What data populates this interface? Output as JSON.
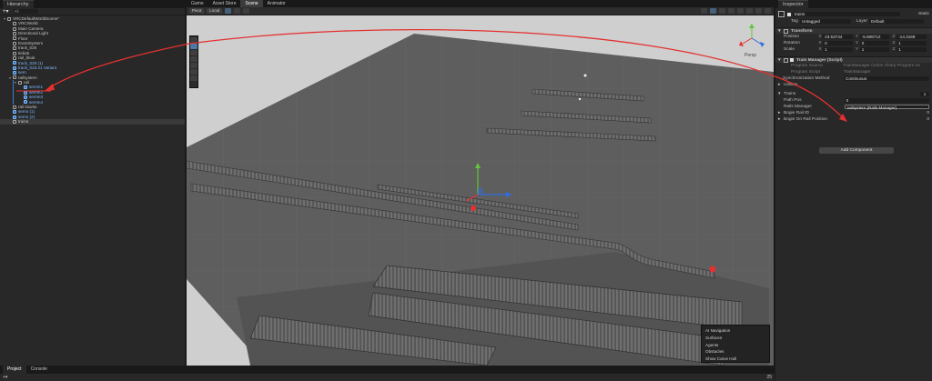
{
  "hierarchy": {
    "tab_label": "Hierarchy",
    "search_placeholder": "All",
    "items": [
      {
        "label": "VRCDefaultWorldScene*",
        "depth": 0,
        "type": "scene"
      },
      {
        "label": "VRCWorld",
        "depth": 1,
        "type": "normal"
      },
      {
        "label": "Main Camera",
        "depth": 1,
        "type": "normal"
      },
      {
        "label": "Directional Light",
        "depth": 1,
        "type": "normal"
      },
      {
        "label": "Floor",
        "depth": 1,
        "type": "normal"
      },
      {
        "label": "EventSystem",
        "depth": 1,
        "type": "normal"
      },
      {
        "label": "track_025",
        "depth": 1,
        "type": "normal"
      },
      {
        "label": "tiebek",
        "depth": 1,
        "type": "normal"
      },
      {
        "label": "rail_bkuk",
        "depth": 1,
        "type": "normal"
      },
      {
        "label": "track_025 (1)",
        "depth": 1,
        "type": "prefab"
      },
      {
        "label": "track_023.21 Variant",
        "depth": 1,
        "type": "prefab"
      },
      {
        "label": "sem",
        "depth": 1,
        "type": "prefab"
      },
      {
        "label": "railsystem",
        "depth": 1,
        "type": "normal"
      },
      {
        "label": "rail",
        "depth": 2,
        "type": "normal"
      },
      {
        "label": "semm1",
        "depth": 3,
        "type": "prefab"
      },
      {
        "label": "semm2",
        "depth": 3,
        "type": "prefab"
      },
      {
        "label": "semm3",
        "depth": 3,
        "type": "prefab"
      },
      {
        "label": "semm4",
        "depth": 3,
        "type": "prefab"
      },
      {
        "label": "rail tiowitu",
        "depth": 1,
        "type": "normal"
      },
      {
        "label": "semo (1)",
        "depth": 1,
        "type": "prefab"
      },
      {
        "label": "semo (2)",
        "depth": 1,
        "type": "prefab"
      },
      {
        "label": "trains",
        "depth": 1,
        "type": "selected"
      }
    ]
  },
  "scene": {
    "tabs": [
      "Game",
      "Asset Store",
      "Scene",
      "Animator"
    ],
    "active_tab": "Scene",
    "toolbar": {
      "pivot": "Pivot",
      "space": "Local"
    },
    "persp_label": "Persp"
  },
  "nav_overlay": {
    "title": "AI Navigation",
    "items": [
      "Surfaces",
      "Agents",
      "Obstacles",
      "Show Carve Hull"
    ]
  },
  "inspector": {
    "tab_label": "Inspector",
    "object_name": "trains",
    "static_label": "Static",
    "tag_label": "Tag",
    "tag_value": "Untagged",
    "layer_label": "Layer",
    "layer_value": "Default",
    "transform": {
      "title": "Transform",
      "position": {
        "label": "Position",
        "x": "23.53734",
        "y": "-5.808712",
        "z": "-14.3168"
      },
      "rotation": {
        "label": "Rotation",
        "x": "0",
        "y": "0",
        "z": "1"
      },
      "scale": {
        "label": "Scale",
        "x": "1",
        "y": "1",
        "z": "1"
      }
    },
    "component": {
      "title": "Train Manager (Script)",
      "program_source_label": "Program Source",
      "program_source_value": "TrainManager (Udon Sharp Program As",
      "program_script_label": "Program Script",
      "program_script_value": "TrainManager",
      "sync_label": "Synchronization Method",
      "sync_value": "Continuous",
      "utilities_label": "Utilities",
      "trains_label": "Trains",
      "trains_count": "1",
      "path_pos_label": "Path Pos",
      "path_pos_count": "0",
      "rails_manager_label": "Rails Manager",
      "rails_manager_value": "railsystem (Rails Manager)",
      "bogie_rail_id_label": "Bogie Rail ID",
      "bogie_rail_id_count": "0",
      "bogie_on_rail_label": "Bogie On Rail Position",
      "bogie_on_rail_count": "0"
    },
    "add_component_label": "Add Component"
  },
  "bottom": {
    "tabs": [
      "Project",
      "Console"
    ],
    "active_tab": "Project",
    "count": "25"
  },
  "colors": {
    "accent_red": "#e53030",
    "selection_blue": "#3b7cd0",
    "prefab_blue": "#7cb9ff"
  }
}
